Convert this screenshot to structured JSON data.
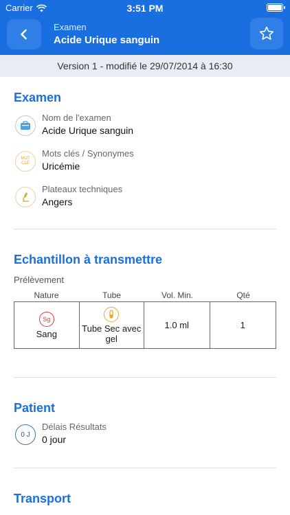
{
  "status": {
    "carrier": "Carrier",
    "time": "3:51 PM"
  },
  "header": {
    "subtitle": "Examen",
    "title": "Acide Urique sanguin"
  },
  "version_bar": {
    "text": "Version 1 - modifié le 29/07/2014 à 16:30"
  },
  "examen": {
    "title": "Examen",
    "items": [
      {
        "label": "Nom de l'examen",
        "value": "Acide Urique sanguin",
        "icon": "briefcase-icon"
      },
      {
        "label": "Mots clés / Synonymes",
        "value": "Uricémie",
        "icon": "keyword-icon",
        "icon_text": "MOT\nCLÉ"
      },
      {
        "label": "Plateaux techniques",
        "value": "Angers",
        "icon": "microscope-icon"
      }
    ]
  },
  "echantillon": {
    "title": "Echantillon à transmettre",
    "subtitle": "Prélèvement",
    "columns": [
      "Nature",
      "Tube",
      "Vol. Min.",
      "Qté"
    ],
    "row": {
      "nature_icon_text": "Sg",
      "nature": "Sang",
      "tube": "Tube Sec avec gel",
      "vol_min": "1.0 ml",
      "qte": "1"
    }
  },
  "patient": {
    "title": "Patient",
    "items": [
      {
        "label": "Délais Résultats",
        "value": "0 jour",
        "icon": "delay-icon",
        "icon_text": "0 J"
      }
    ]
  },
  "transport": {
    "title": "Transport"
  },
  "colors": {
    "primary": "#1a6fe0",
    "version_bg": "#e8edf5",
    "accent_orange": "#e0a93a",
    "accent_red": "#e33333",
    "icon_blue": "#4aa3e0"
  }
}
